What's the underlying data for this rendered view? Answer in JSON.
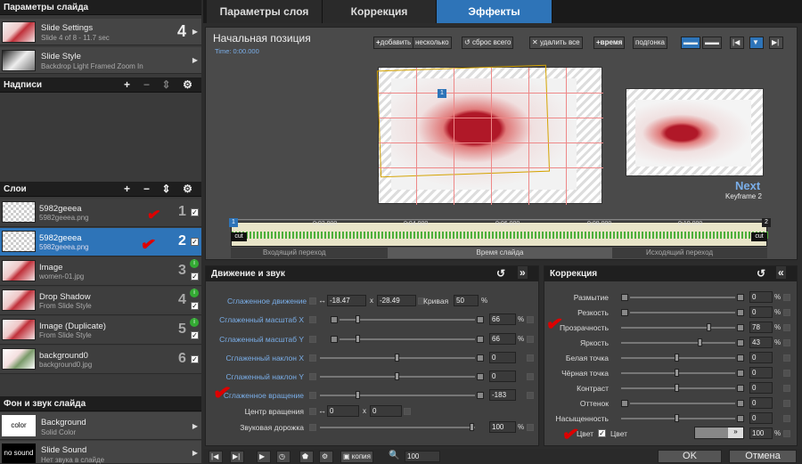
{
  "left": {
    "slide_header": "Параметры слайда",
    "slide_settings": {
      "title": "Slide Settings",
      "sub": "Slide 4 of 8 - 11.7 sec",
      "num": "4"
    },
    "slide_style": {
      "title": "Slide Style",
      "sub": "Backdrop Light Framed Zoom In"
    },
    "captions_header": "Надписи",
    "layers_header": "Слои",
    "layers": [
      {
        "title": "5982geeea",
        "file": "5982geeea.png",
        "num": "1"
      },
      {
        "title": "5982geeea",
        "file": "5982geeea.png",
        "num": "2"
      },
      {
        "title": "Image",
        "file": "women-01.jpg",
        "num": "3"
      },
      {
        "title": "Drop Shadow",
        "file": "From Slide Style",
        "num": "4"
      },
      {
        "title": "Image (Duplicate)",
        "file": "From Slide Style",
        "num": "5"
      },
      {
        "title": "background0",
        "file": "background0.jpg",
        "num": "6"
      }
    ],
    "bg_header": "Фон и звук слайда",
    "background": {
      "thumb": "color",
      "title": "Background",
      "sub": "Solid Color"
    },
    "sound": {
      "thumb": "no sound",
      "title": "Slide Sound",
      "sub": "Нет звука в слайде"
    }
  },
  "tabs": [
    "Параметры слоя",
    "Коррекция",
    "Эффекты"
  ],
  "keyframe": {
    "title": "Начальная позиция",
    "time": "Time: 0:00.000",
    "add": "добавить",
    "several": "несколько",
    "reset_all": "сброс всего",
    "delete_all": "удалить все",
    "time_btn": "время",
    "fit": "подгонка",
    "next": "Next",
    "keyframe2": "Keyframe 2",
    "ticks": [
      "0:02,000",
      "0:04,000",
      "0:06,000",
      "0:08,000",
      "0:10,000"
    ],
    "in_trans": "Входящий переход",
    "slide_time": "Время слайда",
    "out_trans": "Исходящий переход",
    "cut": "cut",
    "marker1": "1",
    "marker2": "2"
  },
  "motion": {
    "header": "Движение и звук",
    "smooth_motion": "Сглаженное движение",
    "mx": "-18.47",
    "my": "-28.49",
    "curve": "Кривая",
    "curve_val": "50",
    "pct": "%",
    "rows": [
      {
        "label": "Сглаженный масштаб X",
        "val": "66"
      },
      {
        "label": "Сглаженный масштаб Y",
        "val": "66"
      },
      {
        "label": "Сглаженный наклон X",
        "val": "0"
      },
      {
        "label": "Сглаженный наклон Y",
        "val": "0"
      },
      {
        "label": "Сглаженное вращение",
        "val": "-183"
      }
    ],
    "rot_center": "Центр вращения",
    "cx": "0",
    "cy": "0",
    "audio": "Звуковая дорожка",
    "audio_val": "100"
  },
  "correction": {
    "header": "Коррекция",
    "rows": [
      {
        "label": "Размытие",
        "val": "0"
      },
      {
        "label": "Резкость",
        "val": "0"
      },
      {
        "label": "Прозрачность",
        "val": "78"
      },
      {
        "label": "Яркость",
        "val": "43"
      },
      {
        "label": "Белая точка",
        "val": "0"
      },
      {
        "label": "Чёрная точка",
        "val": "0"
      },
      {
        "label": "Контраст",
        "val": "0"
      },
      {
        "label": "Оттенок",
        "val": "0"
      },
      {
        "label": "Насыщенность",
        "val": "0"
      }
    ],
    "color_label": "Цвет",
    "color_label2": "Цвет",
    "color_val": "100"
  },
  "bottom": {
    "copy": "копия",
    "zoom": "100",
    "ok": "OK",
    "cancel": "Отмена"
  },
  "colors": {
    "accent": "#2e74b8",
    "waveform": "#4caf3a",
    "check": "#dd0000"
  }
}
